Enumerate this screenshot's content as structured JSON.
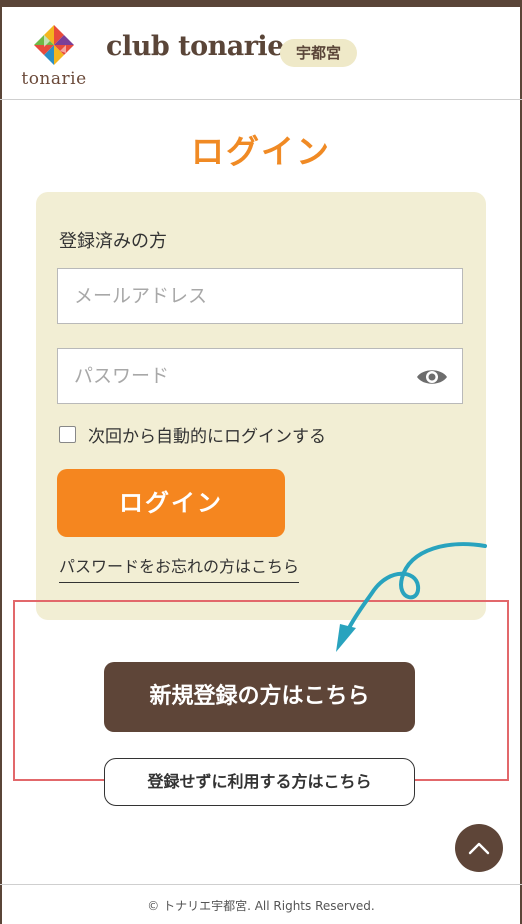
{
  "header": {
    "logo_text": "tonarie",
    "brand_name": "club tonarie",
    "location_badge": "宇都宮"
  },
  "page": {
    "title": "ログイン"
  },
  "login_form": {
    "section_label": "登録済みの方",
    "email_placeholder": "メールアドレス",
    "password_placeholder": "パスワード",
    "remember_label": "次回から自動的にログインする",
    "login_button": "ログイン",
    "forgot_link": "パスワードをお忘れの方はこちら"
  },
  "actions": {
    "register_button": "新規登録の方はこちら",
    "guest_button": "登録せずに利用する方はこちら"
  },
  "footer": {
    "copyright": "© トナリエ宇都宮. All Rights Reserved."
  },
  "colors": {
    "brand_brown": "#5e4538",
    "accent_orange": "#f5861f",
    "card_beige": "#f2eed4",
    "highlight_red": "#e2686b",
    "arrow_teal": "#29a3be"
  },
  "icons": {
    "password_toggle": "eye-icon",
    "back_to_top": "chevron-up-icon",
    "annotation": "curved-arrow-icon"
  }
}
